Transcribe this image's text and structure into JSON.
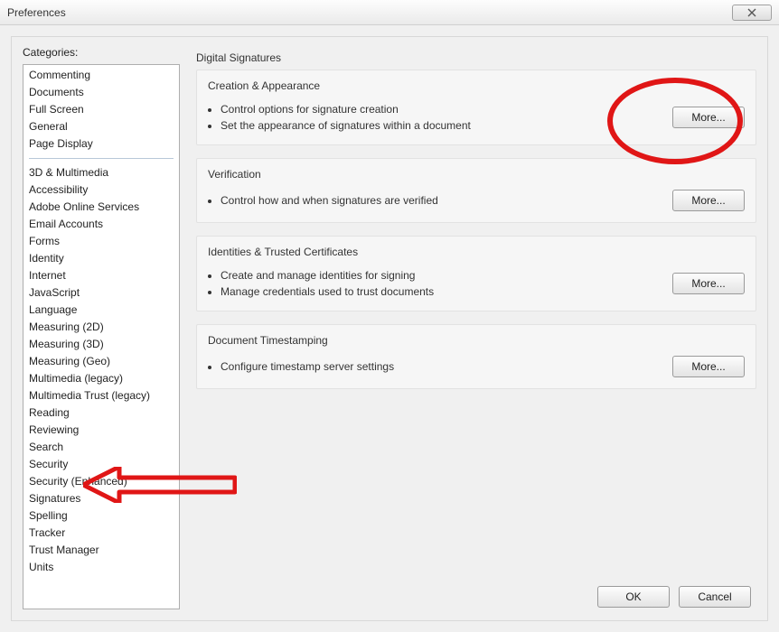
{
  "title": "Preferences",
  "categories_label": "Categories:",
  "categories_top": [
    "Commenting",
    "Documents",
    "Full Screen",
    "General",
    "Page Display"
  ],
  "categories_bottom": [
    "3D & Multimedia",
    "Accessibility",
    "Adobe Online Services",
    "Email Accounts",
    "Forms",
    "Identity",
    "Internet",
    "JavaScript",
    "Language",
    "Measuring (2D)",
    "Measuring (3D)",
    "Measuring (Geo)",
    "Multimedia (legacy)",
    "Multimedia Trust (legacy)",
    "Reading",
    "Reviewing",
    "Search",
    "Security",
    "Security (Enhanced)",
    "Signatures",
    "Spelling",
    "Tracker",
    "Trust Manager",
    "Units"
  ],
  "panel_heading": "Digital Signatures",
  "groups": [
    {
      "title": "Creation & Appearance",
      "bullets": [
        "Control options for signature creation",
        "Set the appearance of signatures within a document"
      ],
      "button": "More..."
    },
    {
      "title": "Verification",
      "bullets": [
        "Control how and when signatures are verified"
      ],
      "button": "More..."
    },
    {
      "title": "Identities & Trusted Certificates",
      "bullets": [
        "Create and manage identities for signing",
        "Manage credentials used to trust documents"
      ],
      "button": "More..."
    },
    {
      "title": "Document Timestamping",
      "bullets": [
        "Configure timestamp server settings"
      ],
      "button": "More..."
    }
  ],
  "buttons": {
    "ok": "OK",
    "cancel": "Cancel"
  }
}
